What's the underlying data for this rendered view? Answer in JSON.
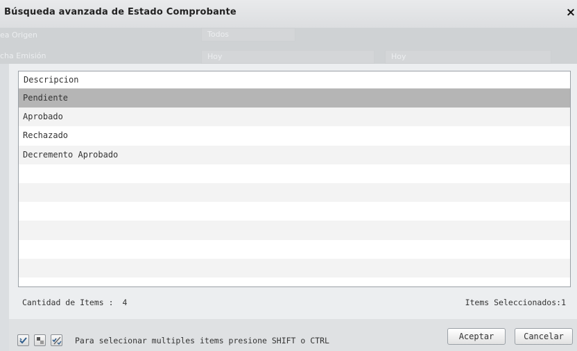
{
  "dialog": {
    "title": "Búsqueda avanzada de Estado Comprobante",
    "close_label": "×"
  },
  "background": {
    "fields": [
      {
        "label": "ea Origen",
        "value": "Todos"
      },
      {
        "label": "cha Emisión",
        "value": "Hoy",
        "value2": "Hoy"
      }
    ]
  },
  "grid": {
    "column_header": "Descripcion",
    "rows": [
      {
        "label": "Pendiente",
        "selected": true
      },
      {
        "label": "Aprobado",
        "selected": false
      },
      {
        "label": "Rechazado",
        "selected": false
      },
      {
        "label": "Decremento Aprobado",
        "selected": false
      }
    ],
    "empty_rows": 7
  },
  "status": {
    "count_label": "Cantidad de Items :",
    "count_value": "4",
    "selected_label": "Items Seleccionados:",
    "selected_value": "1"
  },
  "footer": {
    "hint": "Para selecionar multiples items presione SHIFT o CTRL",
    "accept_label": "Aceptar",
    "cancel_label": "Cancelar"
  },
  "icons": {
    "select_all": "check-all-icon",
    "deselect_all": "deselect-icon",
    "invert": "invert-selection-icon"
  }
}
